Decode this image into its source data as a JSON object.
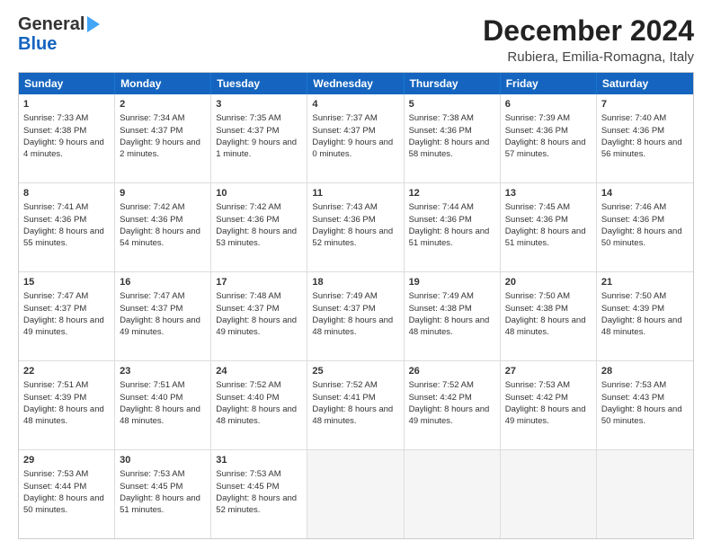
{
  "header": {
    "logo_line1": "General",
    "logo_line2": "Blue",
    "title": "December 2024",
    "subtitle": "Rubiera, Emilia-Romagna, Italy"
  },
  "calendar": {
    "days": [
      "Sunday",
      "Monday",
      "Tuesday",
      "Wednesday",
      "Thursday",
      "Friday",
      "Saturday"
    ],
    "rows": [
      [
        {
          "day": 1,
          "sunrise": "7:33 AM",
          "sunset": "4:38 PM",
          "daylight": "9 hours and 4 minutes."
        },
        {
          "day": 2,
          "sunrise": "7:34 AM",
          "sunset": "4:37 PM",
          "daylight": "9 hours and 2 minutes."
        },
        {
          "day": 3,
          "sunrise": "7:35 AM",
          "sunset": "4:37 PM",
          "daylight": "9 hours and 1 minute."
        },
        {
          "day": 4,
          "sunrise": "7:37 AM",
          "sunset": "4:37 PM",
          "daylight": "9 hours and 0 minutes."
        },
        {
          "day": 5,
          "sunrise": "7:38 AM",
          "sunset": "4:36 PM",
          "daylight": "8 hours and 58 minutes."
        },
        {
          "day": 6,
          "sunrise": "7:39 AM",
          "sunset": "4:36 PM",
          "daylight": "8 hours and 57 minutes."
        },
        {
          "day": 7,
          "sunrise": "7:40 AM",
          "sunset": "4:36 PM",
          "daylight": "8 hours and 56 minutes."
        }
      ],
      [
        {
          "day": 8,
          "sunrise": "7:41 AM",
          "sunset": "4:36 PM",
          "daylight": "8 hours and 55 minutes."
        },
        {
          "day": 9,
          "sunrise": "7:42 AM",
          "sunset": "4:36 PM",
          "daylight": "8 hours and 54 minutes."
        },
        {
          "day": 10,
          "sunrise": "7:42 AM",
          "sunset": "4:36 PM",
          "daylight": "8 hours and 53 minutes."
        },
        {
          "day": 11,
          "sunrise": "7:43 AM",
          "sunset": "4:36 PM",
          "daylight": "8 hours and 52 minutes."
        },
        {
          "day": 12,
          "sunrise": "7:44 AM",
          "sunset": "4:36 PM",
          "daylight": "8 hours and 51 minutes."
        },
        {
          "day": 13,
          "sunrise": "7:45 AM",
          "sunset": "4:36 PM",
          "daylight": "8 hours and 51 minutes."
        },
        {
          "day": 14,
          "sunrise": "7:46 AM",
          "sunset": "4:36 PM",
          "daylight": "8 hours and 50 minutes."
        }
      ],
      [
        {
          "day": 15,
          "sunrise": "7:47 AM",
          "sunset": "4:37 PM",
          "daylight": "8 hours and 49 minutes."
        },
        {
          "day": 16,
          "sunrise": "7:47 AM",
          "sunset": "4:37 PM",
          "daylight": "8 hours and 49 minutes."
        },
        {
          "day": 17,
          "sunrise": "7:48 AM",
          "sunset": "4:37 PM",
          "daylight": "8 hours and 49 minutes."
        },
        {
          "day": 18,
          "sunrise": "7:49 AM",
          "sunset": "4:37 PM",
          "daylight": "8 hours and 48 minutes."
        },
        {
          "day": 19,
          "sunrise": "7:49 AM",
          "sunset": "4:38 PM",
          "daylight": "8 hours and 48 minutes."
        },
        {
          "day": 20,
          "sunrise": "7:50 AM",
          "sunset": "4:38 PM",
          "daylight": "8 hours and 48 minutes."
        },
        {
          "day": 21,
          "sunrise": "7:50 AM",
          "sunset": "4:39 PM",
          "daylight": "8 hours and 48 minutes."
        }
      ],
      [
        {
          "day": 22,
          "sunrise": "7:51 AM",
          "sunset": "4:39 PM",
          "daylight": "8 hours and 48 minutes."
        },
        {
          "day": 23,
          "sunrise": "7:51 AM",
          "sunset": "4:40 PM",
          "daylight": "8 hours and 48 minutes."
        },
        {
          "day": 24,
          "sunrise": "7:52 AM",
          "sunset": "4:40 PM",
          "daylight": "8 hours and 48 minutes."
        },
        {
          "day": 25,
          "sunrise": "7:52 AM",
          "sunset": "4:41 PM",
          "daylight": "8 hours and 48 minutes."
        },
        {
          "day": 26,
          "sunrise": "7:52 AM",
          "sunset": "4:42 PM",
          "daylight": "8 hours and 49 minutes."
        },
        {
          "day": 27,
          "sunrise": "7:53 AM",
          "sunset": "4:42 PM",
          "daylight": "8 hours and 49 minutes."
        },
        {
          "day": 28,
          "sunrise": "7:53 AM",
          "sunset": "4:43 PM",
          "daylight": "8 hours and 50 minutes."
        }
      ],
      [
        {
          "day": 29,
          "sunrise": "7:53 AM",
          "sunset": "4:44 PM",
          "daylight": "8 hours and 50 minutes."
        },
        {
          "day": 30,
          "sunrise": "7:53 AM",
          "sunset": "4:45 PM",
          "daylight": "8 hours and 51 minutes."
        },
        {
          "day": 31,
          "sunrise": "7:53 AM",
          "sunset": "4:45 PM",
          "daylight": "8 hours and 52 minutes."
        },
        null,
        null,
        null,
        null
      ]
    ],
    "labels": {
      "sunrise": "Sunrise:",
      "sunset": "Sunset:",
      "daylight": "Daylight:"
    }
  }
}
